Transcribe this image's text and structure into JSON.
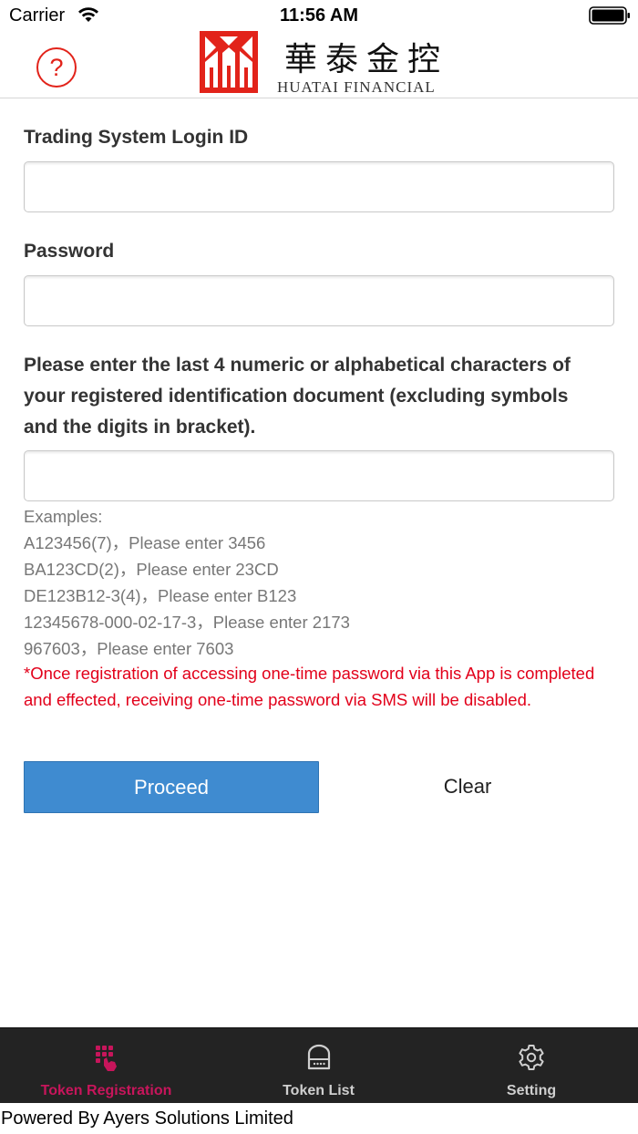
{
  "status_bar": {
    "carrier": "Carrier",
    "time": "11:56 AM",
    "icons": [
      "wifi-icon",
      "battery-icon"
    ]
  },
  "header": {
    "help_symbol": "?",
    "logo_chinese": "華泰金控",
    "logo_english": "HUATAI FINANCIAL",
    "accent_color": "#e2231a"
  },
  "form": {
    "login_id_label": "Trading System Login ID",
    "login_id_value": "",
    "password_label": "Password",
    "password_value": "",
    "id_doc_label": "Please enter the last 4 numeric or alphabetical characters of your registered identification document (excluding symbols and the digits in bracket).",
    "id_doc_value": "",
    "examples_title": "Examples:",
    "examples": [
      "A123456(7)，Please enter 3456",
      "BA123CD(2)，Please enter 23CD",
      "DE123B12-3(4)，Please enter B123",
      "12345678-000-02-17-3，Please enter 2173",
      "967603，Please enter 7603"
    ],
    "warning": "*Once registration of accessing one-time password via this App is completed and effected, receiving one-time password via SMS will be disabled.",
    "warning_color": "#e2001a"
  },
  "actions": {
    "proceed_label": "Proceed",
    "clear_label": "Clear",
    "proceed_color": "#3f8bd0"
  },
  "tabs": [
    {
      "label": "Token Registration",
      "icon": "keypad-hand-icon",
      "active": true
    },
    {
      "label": "Token List",
      "icon": "token-device-icon",
      "active": false
    },
    {
      "label": "Setting",
      "icon": "gear-icon",
      "active": false
    }
  ],
  "tab_active_color": "#c7155b",
  "footer": {
    "powered_by": "Powered By Ayers Solutions Limited"
  }
}
